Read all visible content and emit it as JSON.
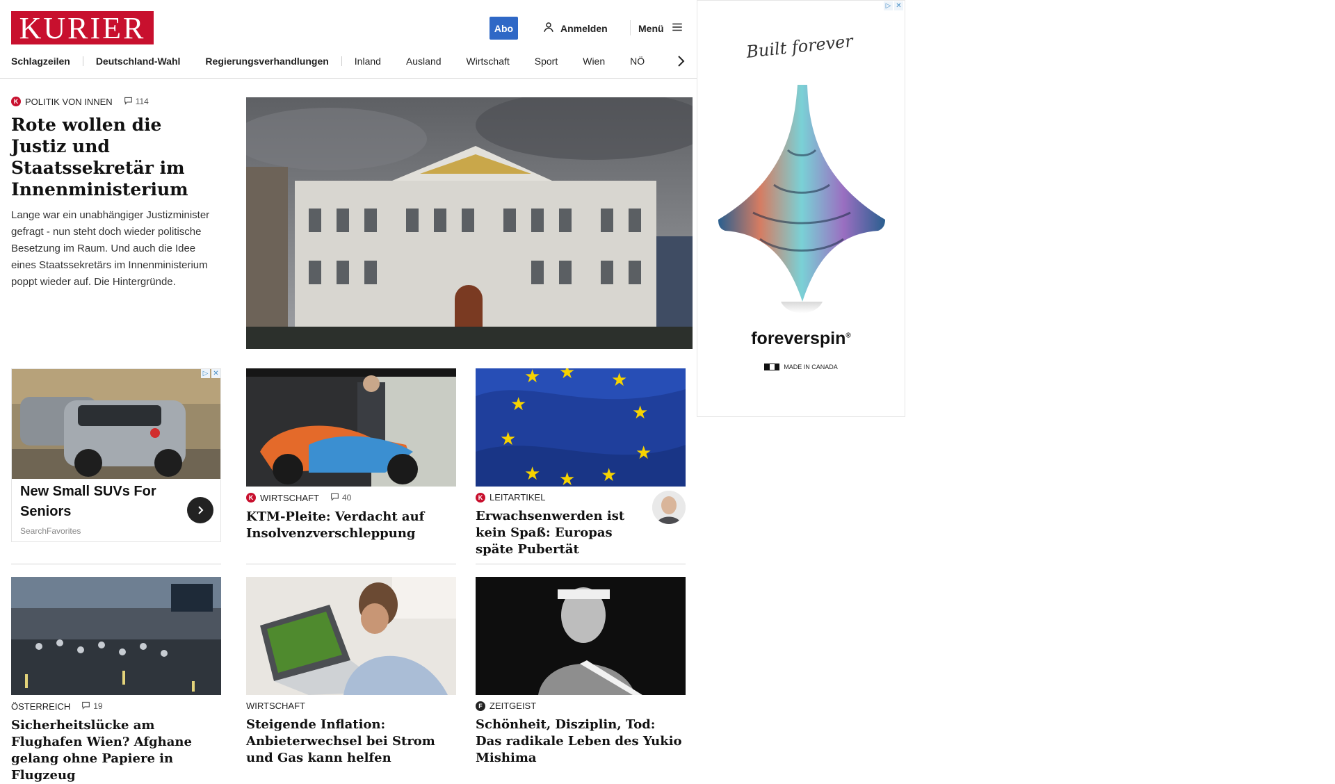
{
  "header": {
    "logo_text": "KURIER",
    "abo_label": "Abo",
    "login_label": "Anmelden",
    "menu_label": "Menü"
  },
  "nav": {
    "items": [
      "Schlagzeilen",
      "Deutschland-Wahl",
      "Regierungsverhandlungen",
      "Inland",
      "Ausland",
      "Wirtschaft",
      "Sport",
      "Wien",
      "NÖ"
    ]
  },
  "lead": {
    "category": "POLITIK VON INNEN",
    "comments": "114",
    "title": "Rote wollen die Justiz und Staatssekretär im Innenministerium",
    "teaser": "Lange war ein unabhängiger Justizminister gefragt - nun steht doch wieder politische Besetzung im Raum. Und auch die Idee eines Staatssekretärs im Innenministerium poppt wieder auf. Die Hintergründe."
  },
  "sponsored": {
    "title": "New Small SUVs For Seniors",
    "source": "SearchFavorites"
  },
  "cards": [
    {
      "category": "WIRTSCHAFT",
      "comments": "40",
      "title": "KTM-Pleite: Verdacht auf Insolvenzverschleppung"
    },
    {
      "category": "LEITARTIKEL",
      "title": "Erwachsenwerden ist kein Spaß: Europas späte Pubertät"
    },
    {
      "category": "ÖSTERREICH",
      "comments": "19",
      "title": "Sicherheitslücke am Flughafen Wien? Afghane gelang ohne Papiere in Flugzeug"
    },
    {
      "category": "WIRTSCHAFT",
      "title": "Steigende Inflation: Anbieterwechsel bei Strom und Gas kann helfen"
    },
    {
      "category": "ZEITGEIST",
      "title": "Schönheit, Disziplin, Tod: Das radikale Leben des Yukio Mishima"
    }
  ],
  "ad": {
    "script_text": "Built forever",
    "brand": "foreverspin",
    "made_in": "MADE IN CANADA"
  },
  "colors": {
    "brand_red": "#c8102e",
    "abo_blue": "#2f68c6"
  }
}
